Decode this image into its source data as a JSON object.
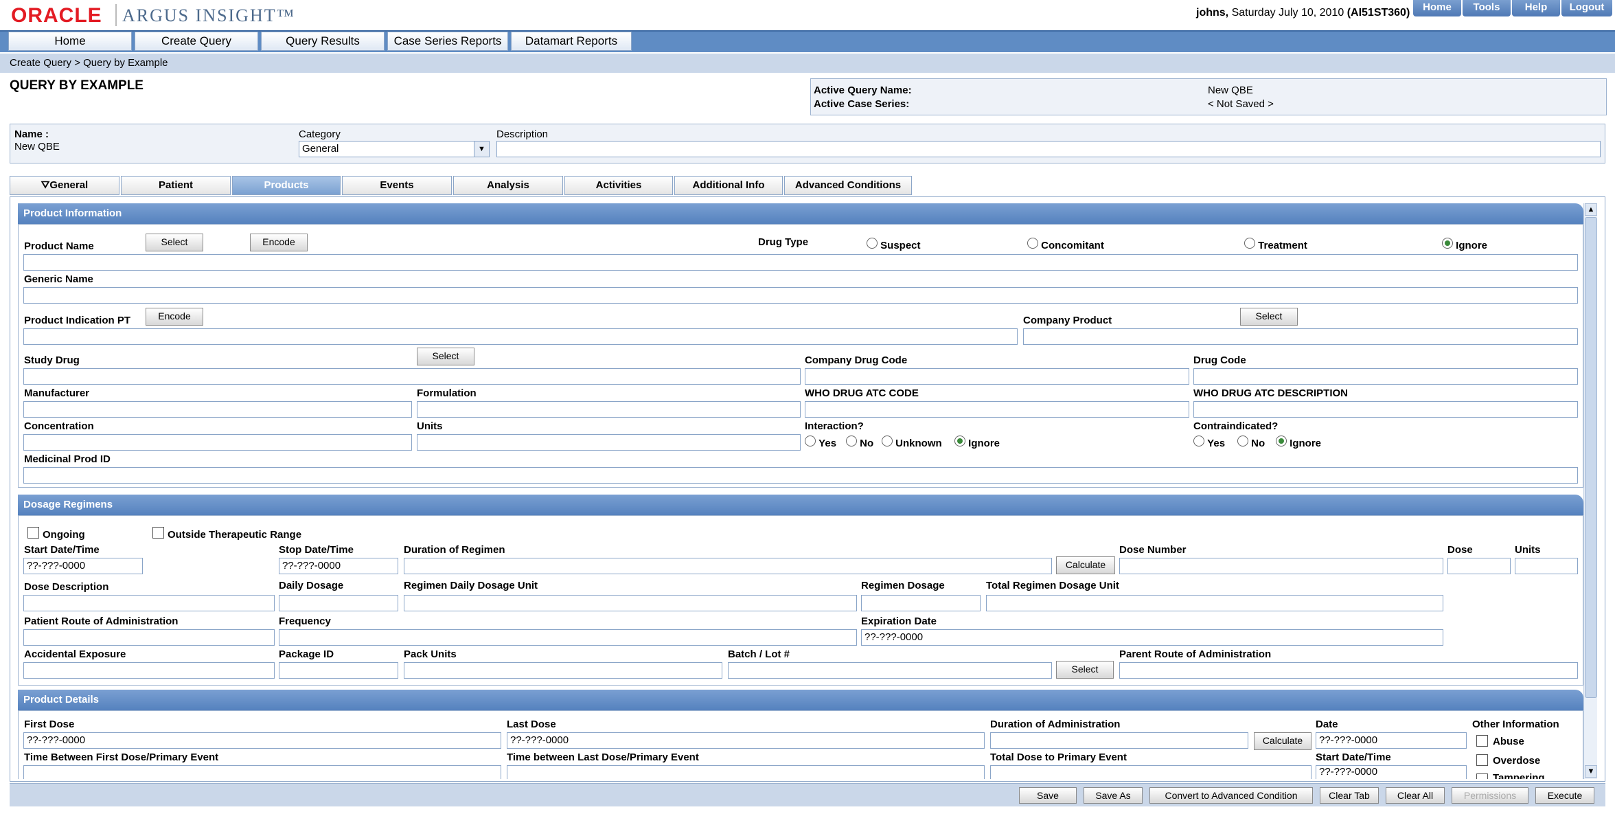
{
  "header": {
    "logo_oracle": "ORACLE",
    "logo_product": "ARGUS INSIGHT™",
    "user": "johns,",
    "date": "Saturday July 10, 2010",
    "session": "(AI51ST360)",
    "top_links": [
      "Home",
      "Tools",
      "Help",
      "Logout"
    ]
  },
  "main_tabs": [
    "Home",
    "Create Query",
    "Query Results",
    "Case Series Reports",
    "Datamart Reports"
  ],
  "breadcrumb": "Create Query  >  Query by Example",
  "page_title": "QUERY BY EXAMPLE",
  "active_query": {
    "name_label": "Active Query Name:",
    "name_value": "New QBE",
    "series_label": "Active Case Series:",
    "series_value": "< Not Saved >"
  },
  "query_info": {
    "name_label": "Name :",
    "name_value": "New QBE",
    "category_label": "Category",
    "category_value": "General",
    "description_label": "Description",
    "description_value": ""
  },
  "tabs": [
    "General",
    "Patient",
    "Products",
    "Events",
    "Analysis",
    "Activities",
    "Additional Info",
    "Advanced Conditions"
  ],
  "product_info": {
    "title": "Product Information",
    "product_name": "Product Name",
    "select": "Select",
    "encode": "Encode",
    "drug_type": "Drug Type",
    "drug_type_options": [
      "Suspect",
      "Concomitant",
      "Treatment",
      "Ignore"
    ],
    "generic_name": "Generic Name",
    "product_indication": "Product Indication PT",
    "company_product": "Company Product",
    "study_drug": "Study Drug",
    "company_drug_code": "Company Drug Code",
    "drug_code": "Drug Code",
    "manufacturer": "Manufacturer",
    "formulation": "Formulation",
    "who_atc_code": "WHO DRUG ATC CODE",
    "who_atc_desc": "WHO DRUG ATC DESCRIPTION",
    "concentration": "Concentration",
    "units": "Units",
    "interaction": "Interaction?",
    "interaction_options": [
      "Yes",
      "No",
      "Unknown",
      "Ignore"
    ],
    "contraindicated": "Contraindicated?",
    "contraindicated_options": [
      "Yes",
      "No",
      "Ignore"
    ],
    "medicinal_prod_id": "Medicinal Prod ID"
  },
  "dosage": {
    "title": "Dosage Regimens",
    "ongoing": "Ongoing",
    "outside_range": "Outside Therapeutic Range",
    "start_dt": "Start Date/Time",
    "start_dt_value": "??-???-0000",
    "stop_dt": "Stop Date/Time",
    "stop_dt_value": "??-???-0000",
    "duration": "Duration of Regimen",
    "calculate": "Calculate",
    "dose_number": "Dose Number",
    "dose": "Dose",
    "units": "Units",
    "dose_description": "Dose Description",
    "daily_dosage": "Daily Dosage",
    "regimen_daily_unit": "Regimen Daily Dosage Unit",
    "regimen_dosage": "Regimen Dosage",
    "total_regimen_unit": "Total Regimen Dosage Unit",
    "route": "Patient Route of Administration",
    "frequency": "Frequency",
    "expiration": "Expiration Date",
    "expiration_value": "??-???-0000",
    "accidental": "Accidental Exposure",
    "package_id": "Package ID",
    "pack_units": "Pack Units",
    "batch": "Batch / Lot #",
    "select": "Select",
    "parent_route": "Parent Route of Administration"
  },
  "product_details": {
    "title": "Product Details",
    "first_dose": "First Dose",
    "first_dose_value": "??-???-0000",
    "last_dose": "Last Dose",
    "last_dose_value": "??-???-0000",
    "duration_admin": "Duration of Administration",
    "calculate": "Calculate",
    "date": "Date",
    "date_value": "??-???-0000",
    "other_info": "Other Information",
    "abuse": "Abuse",
    "overdose": "Overdose",
    "tampering": "Tampering",
    "time_first": "Time Between First Dose/Primary Event",
    "time_last": "Time between Last Dose/Primary Event",
    "total_dose": "Total Dose to Primary Event",
    "start_dt": "Start Date/Time",
    "start_dt_value": "??-???-0000"
  },
  "footer_buttons": [
    "Save",
    "Save As",
    "Convert to Advanced Condition",
    "Clear Tab",
    "Clear All",
    "Permissions",
    "Execute"
  ]
}
